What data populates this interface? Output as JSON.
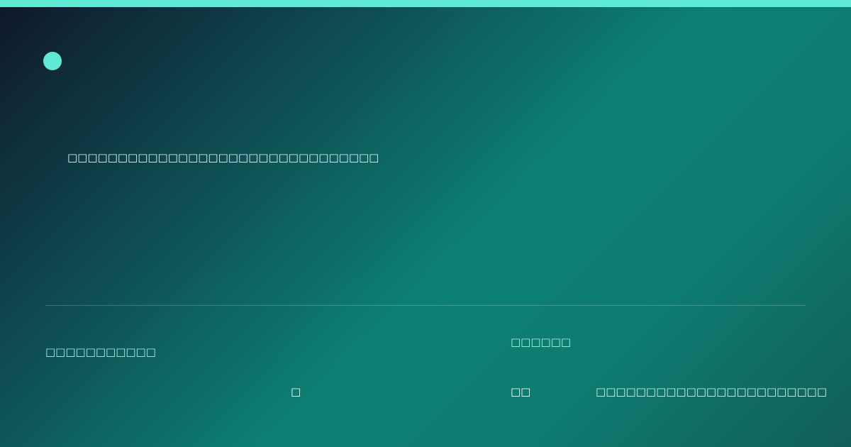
{
  "colors": {
    "accent": "#5eead4",
    "background_start": "#0f172a",
    "background_mid": "#0c8073",
    "background_end": "#115e59"
  },
  "header": {
    "logo_icon": "circle-logo-icon"
  },
  "main": {
    "tagline": "□□□□□□□□□□□□□□□□□□□□□□□□□□□□□□□"
  },
  "footer": {
    "left_label": "□□□□□□□□□□□",
    "mid_value": "□",
    "right_label": "□□□□□□",
    "right_value": "□□",
    "far_right_text": "□□□□□□□□□□□□□□□□□□□□□□□"
  }
}
